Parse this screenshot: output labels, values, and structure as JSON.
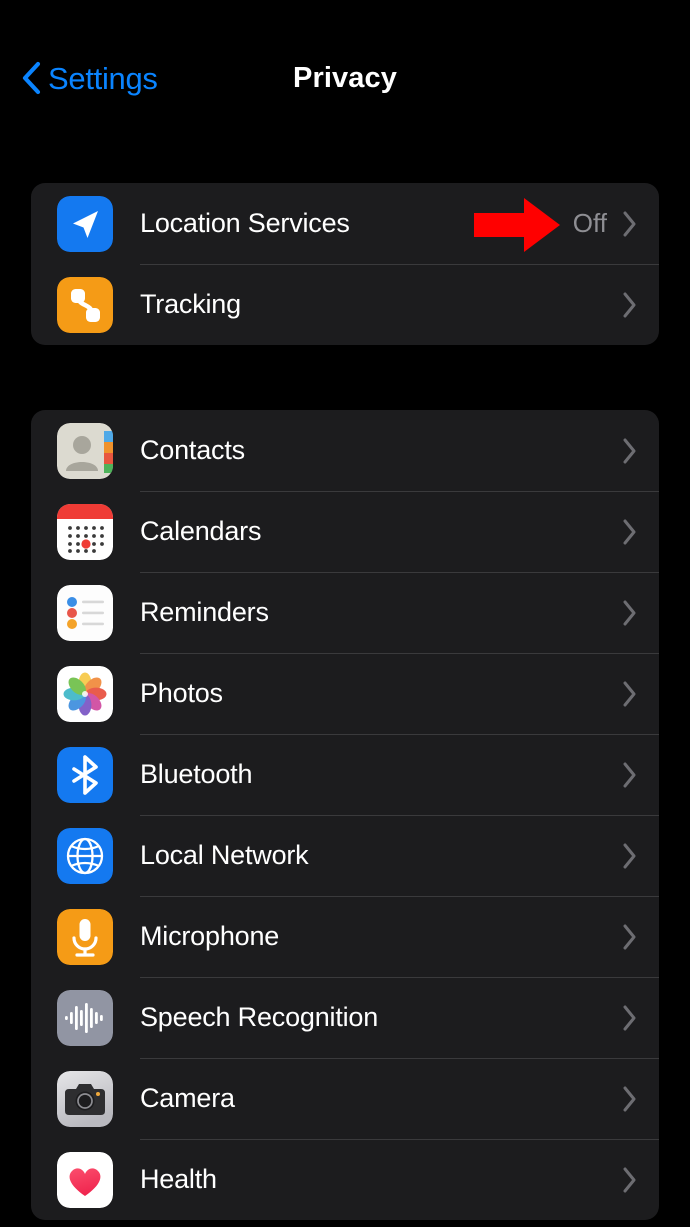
{
  "header": {
    "back_label": "Settings",
    "back_icon": "chevron-left-icon",
    "title": "Privacy"
  },
  "colors": {
    "background": "#000000",
    "card": "#1c1c1e",
    "separator": "#3a3a3c",
    "accent_blue": "#0a84ff",
    "value_gray": "#8e8e93",
    "label_white": "#ffffff",
    "annotation_red": "#ff0000"
  },
  "annotation": {
    "type": "arrow",
    "direction": "right",
    "color": "#ff0000",
    "points_at": "Location Services value Off"
  },
  "groups": [
    {
      "id": "primary",
      "rows": [
        {
          "label": "Location Services",
          "value": "Off",
          "icon": "location-arrow-icon",
          "accessory": "chevron-right-icon"
        },
        {
          "label": "Tracking",
          "value": "",
          "icon": "tracking-link-icon",
          "accessory": "chevron-right-icon"
        }
      ]
    },
    {
      "id": "apps",
      "rows": [
        {
          "label": "Contacts",
          "value": "",
          "icon": "contacts-icon",
          "accessory": "chevron-right-icon"
        },
        {
          "label": "Calendars",
          "value": "",
          "icon": "calendar-icon",
          "accessory": "chevron-right-icon"
        },
        {
          "label": "Reminders",
          "value": "",
          "icon": "reminders-icon",
          "accessory": "chevron-right-icon"
        },
        {
          "label": "Photos",
          "value": "",
          "icon": "photos-icon",
          "accessory": "chevron-right-icon"
        },
        {
          "label": "Bluetooth",
          "value": "",
          "icon": "bluetooth-icon",
          "accessory": "chevron-right-icon"
        },
        {
          "label": "Local Network",
          "value": "",
          "icon": "globe-icon",
          "accessory": "chevron-right-icon"
        },
        {
          "label": "Microphone",
          "value": "",
          "icon": "microphone-icon",
          "accessory": "chevron-right-icon"
        },
        {
          "label": "Speech Recognition",
          "value": "",
          "icon": "waveform-icon",
          "accessory": "chevron-right-icon"
        },
        {
          "label": "Camera",
          "value": "",
          "icon": "camera-icon",
          "accessory": "chevron-right-icon"
        },
        {
          "label": "Health",
          "value": "",
          "icon": "heart-icon",
          "accessory": "chevron-right-icon"
        }
      ]
    }
  ]
}
